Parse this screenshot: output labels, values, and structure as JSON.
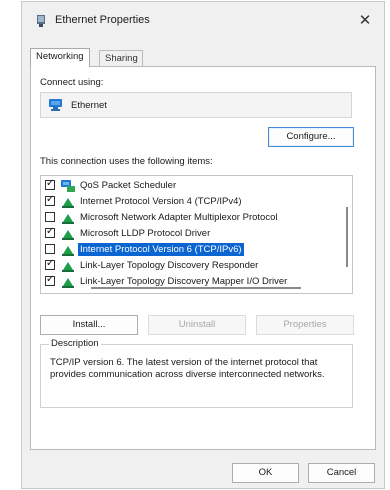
{
  "window": {
    "title": "Ethernet Properties",
    "close_label": "✕"
  },
  "tabs": [
    {
      "label": "Networking",
      "active": true
    },
    {
      "label": "Sharing",
      "active": false
    }
  ],
  "connect_using": {
    "label": "Connect using:",
    "adapter": "Ethernet",
    "configure_label": "Configure..."
  },
  "items_label": "This connection uses the following items:",
  "items": [
    {
      "label": "QoS Packet Scheduler",
      "checked": true,
      "icon": "qos-network-icon"
    },
    {
      "label": "Internet Protocol Version 4 (TCP/IPv4)",
      "checked": true,
      "icon": "protocol-icon"
    },
    {
      "label": "Microsoft Network Adapter Multiplexor Protocol",
      "checked": false,
      "icon": "protocol-icon"
    },
    {
      "label": "Microsoft LLDP Protocol Driver",
      "checked": true,
      "icon": "protocol-icon"
    },
    {
      "label": "Internet Protocol Version 6 (TCP/IPv6)",
      "checked": false,
      "icon": "protocol-icon",
      "selected": true
    },
    {
      "label": "Link-Layer Topology Discovery Responder",
      "checked": true,
      "icon": "protocol-icon"
    },
    {
      "label": "Link-Layer Topology Discovery Mapper I/O Driver",
      "checked": true,
      "icon": "protocol-icon"
    }
  ],
  "buttons": {
    "install": "Install...",
    "uninstall": "Uninstall",
    "properties": "Properties",
    "ok": "OK",
    "cancel": "Cancel"
  },
  "description": {
    "label": "Description",
    "text": "TCP/IP version 6. The latest version of the internet protocol that provides communication across diverse interconnected networks."
  },
  "colors": {
    "selection": "#0a64d1",
    "protocol_green": "#1f9e4a",
    "network_blue": "#1e78d4"
  }
}
